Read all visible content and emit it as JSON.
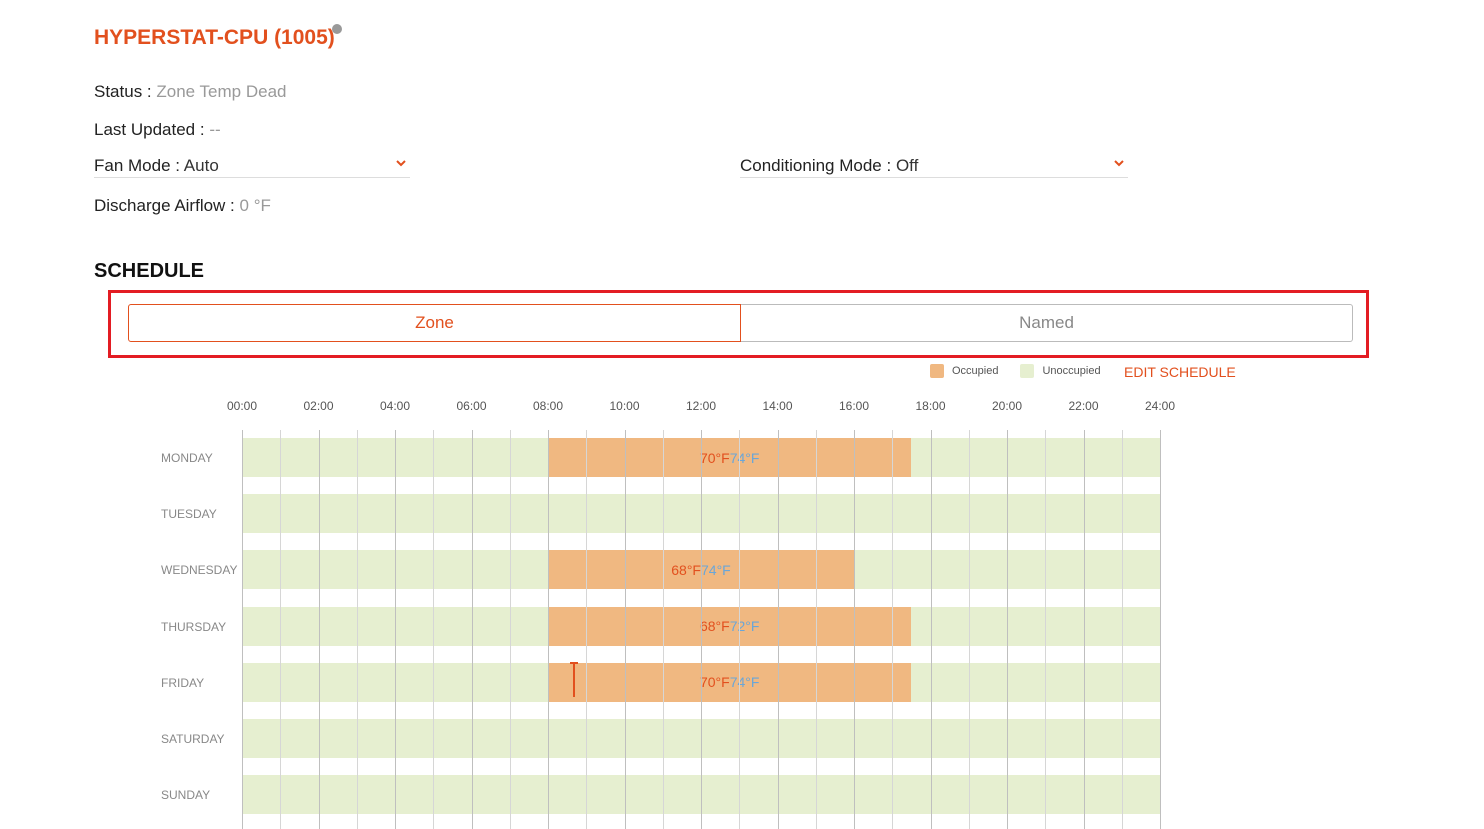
{
  "header": {
    "title": "HYPERSTAT-CPU (1005)"
  },
  "info": {
    "status_label": "Status :",
    "status_value": "Zone Temp Dead",
    "updated_label": "Last Updated :",
    "updated_value": "--",
    "fan_label": "Fan Mode :",
    "fan_value": "Auto",
    "conditioning_label": "Conditioning Mode :",
    "conditioning_value": "Off",
    "airflow_label": "Discharge Airflow :",
    "airflow_value": "0 °F"
  },
  "schedule": {
    "title": "SCHEDULE",
    "tabs": [
      {
        "label": "Zone",
        "active": true
      },
      {
        "label": "Named",
        "active": false
      }
    ],
    "legend": {
      "occupied": "Occupied",
      "unoccupied": "Unoccupied"
    },
    "colors": {
      "occupied": "#f0b881",
      "unoccupied": "#e6efd0",
      "accent": "#e2501e",
      "heat": "#e2501e",
      "cool": "#6aa6d8"
    },
    "edit_label": "EDIT SCHEDULE",
    "hours": [
      "00:00",
      "02:00",
      "04:00",
      "06:00",
      "08:00",
      "10:00",
      "12:00",
      "14:00",
      "16:00",
      "18:00",
      "20:00",
      "22:00",
      "24:00"
    ],
    "days": [
      {
        "name": "MONDAY",
        "occupied": {
          "start": 8,
          "end": 17.5,
          "heat": "70°F",
          "cool": "74°F"
        }
      },
      {
        "name": "TUESDAY",
        "occupied": null
      },
      {
        "name": "WEDNESDAY",
        "occupied": {
          "start": 8,
          "end": 16,
          "heat": "68°F",
          "cool": "74°F"
        }
      },
      {
        "name": "THURSDAY",
        "occupied": {
          "start": 8,
          "end": 17.5,
          "heat": "68°F",
          "cool": "72°F"
        }
      },
      {
        "name": "FRIDAY",
        "occupied": {
          "start": 8,
          "end": 17.5,
          "heat": "70°F",
          "cool": "74°F"
        },
        "current_time": 8.65
      },
      {
        "name": "SATURDAY",
        "occupied": null
      },
      {
        "name": "SUNDAY",
        "occupied": null
      }
    ]
  }
}
